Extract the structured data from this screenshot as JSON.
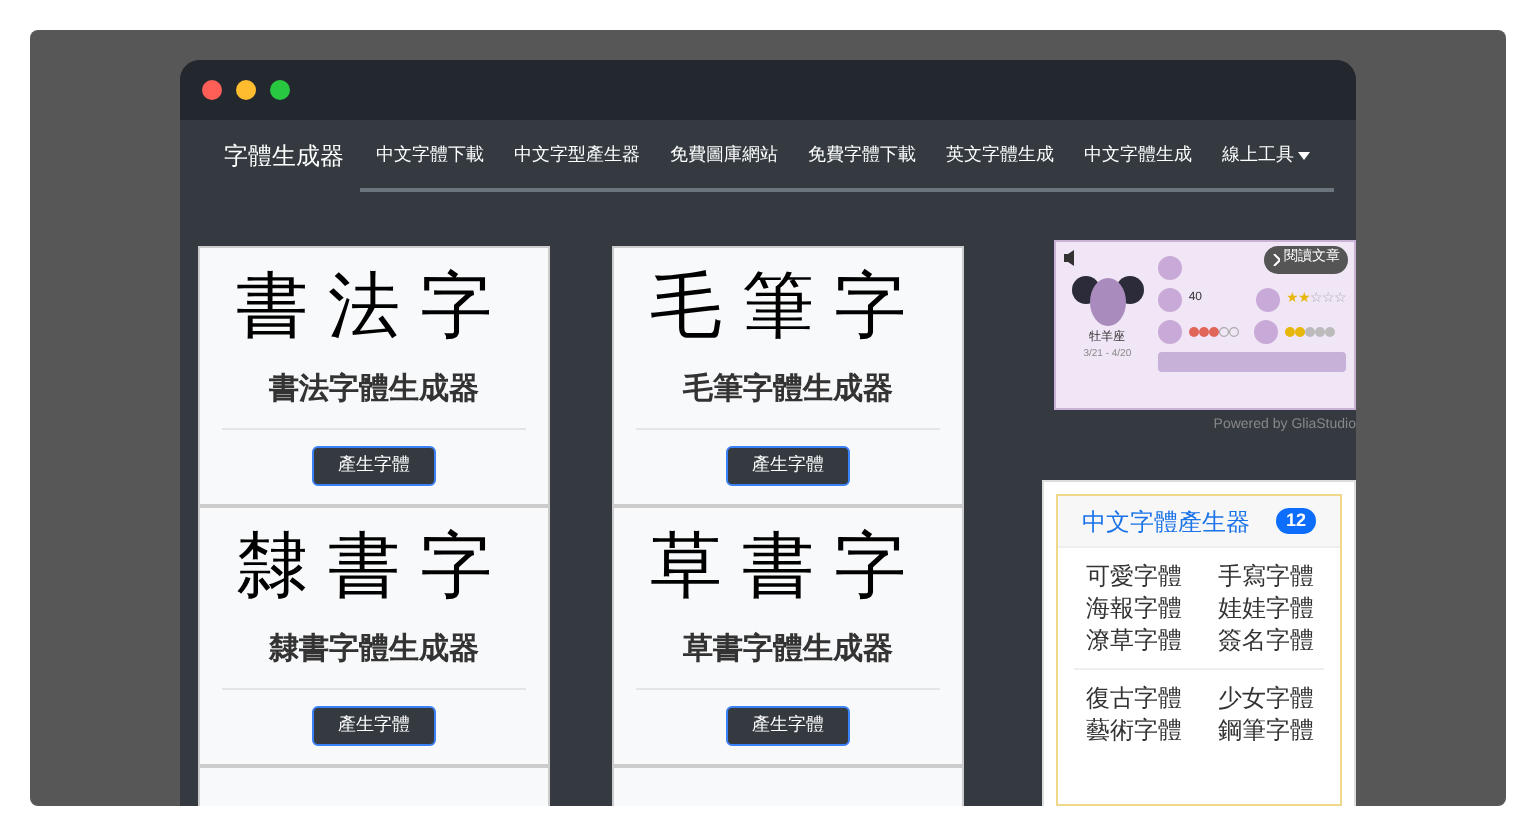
{
  "navbar": {
    "brand": "字體生成器",
    "items": [
      {
        "label": "中文字體下載",
        "dropdown": false
      },
      {
        "label": "中文字型產生器",
        "dropdown": false
      },
      {
        "label": "免費圖庫網站",
        "dropdown": false
      },
      {
        "label": "免費字體下載",
        "dropdown": false
      },
      {
        "label": "英文字體生成",
        "dropdown": false
      },
      {
        "label": "中文字體生成",
        "dropdown": false
      },
      {
        "label": "線上工具",
        "dropdown": true
      }
    ]
  },
  "cards": [
    {
      "sample": "書法字",
      "title": "書法字體生成器",
      "button": "產生字體"
    },
    {
      "sample": "毛筆字",
      "title": "毛筆字體生成器",
      "button": "產生字體"
    },
    {
      "sample": "隸書字",
      "title": "隸書字體生成器",
      "button": "產生字體"
    },
    {
      "sample": "草書字",
      "title": "草書字體生成器",
      "button": "產生字體"
    }
  ],
  "widget": {
    "read_button": "閱讀文章",
    "number": "40",
    "stars": 2,
    "sign": "牡羊座",
    "dates": "3/21 - 4/20",
    "powered_by": "Powered by GliaStudio"
  },
  "font_list": {
    "title": "中文字體產生器",
    "count": "12",
    "groups": [
      [
        "可愛字體",
        "手寫字體",
        "海報字體",
        "娃娃字體",
        "潦草字體",
        "簽名字體"
      ],
      [
        "復古字體",
        "少女字體",
        "藝術字體",
        "鋼筆字體"
      ]
    ]
  }
}
